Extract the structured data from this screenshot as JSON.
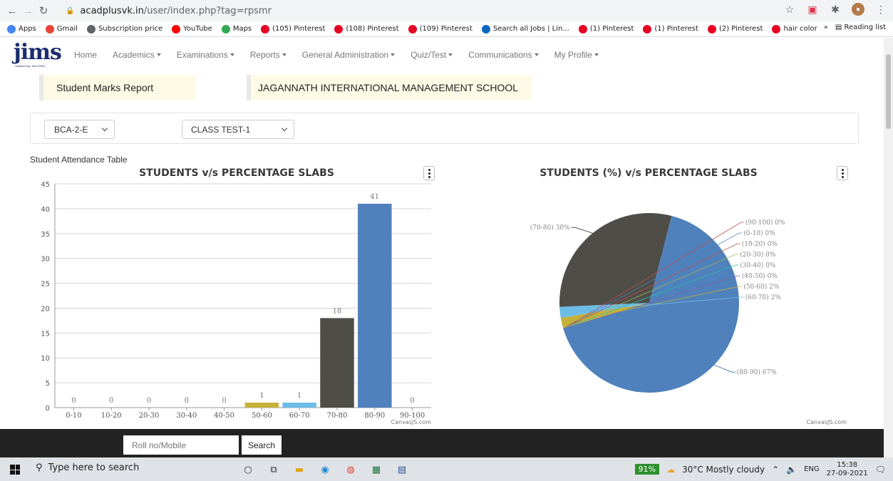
{
  "browser": {
    "url_host": "acadplusvk.in",
    "url_path": "/user/index.php?tag=rpsmr",
    "bookmarks": [
      {
        "label": "Apps",
        "color": "#4285f4"
      },
      {
        "label": "Gmail",
        "color": "#ea4335"
      },
      {
        "label": "Subscription price",
        "color": "#5f6368"
      },
      {
        "label": "YouTube",
        "color": "#ff0000"
      },
      {
        "label": "Maps",
        "color": "#34a853"
      },
      {
        "label": "(105) Pinterest",
        "color": "#e60023"
      },
      {
        "label": "(108) Pinterest",
        "color": "#e60023"
      },
      {
        "label": "(109) Pinterest",
        "color": "#e60023"
      },
      {
        "label": "Search all Jobs | Lin...",
        "color": "#0a66c2"
      },
      {
        "label": "(1) Pinterest",
        "color": "#e60023"
      },
      {
        "label": "(1) Pinterest",
        "color": "#e60023"
      },
      {
        "label": "(2) Pinterest",
        "color": "#e60023"
      },
      {
        "label": "hair color",
        "color": "#e60023"
      }
    ],
    "more": "»",
    "reading_list": "Reading list"
  },
  "nav": {
    "logo": "jims",
    "logo_sub": "Vasant Kunj, New Delhi",
    "items": [
      {
        "label": "Home",
        "dropdown": false
      },
      {
        "label": "Academics",
        "dropdown": true
      },
      {
        "label": "Examinations",
        "dropdown": true
      },
      {
        "label": "Reports",
        "dropdown": true
      },
      {
        "label": "General Administration",
        "dropdown": true
      },
      {
        "label": "Quiz/Test",
        "dropdown": true
      },
      {
        "label": "Communications",
        "dropdown": true
      },
      {
        "label": "My Profile",
        "dropdown": true
      }
    ]
  },
  "header": {
    "report_title": "Student Marks Report",
    "institute": "JAGANNATH INTERNATIONAL MANAGEMENT SCHOOL"
  },
  "filters": {
    "class_value": "BCA-2-E",
    "test_value": "CLASS TEST-1"
  },
  "section_label": "Student Attendance Table",
  "chart_data": [
    {
      "type": "bar",
      "title": "STUDENTS v/s PERCENTAGE SLABS",
      "categories": [
        "0-10",
        "10-20",
        "20-30",
        "30-40",
        "40-50",
        "50-60",
        "60-70",
        "70-80",
        "80-90",
        "90-100"
      ],
      "values": [
        0,
        0,
        0,
        0,
        0,
        1,
        1,
        18,
        41,
        0
      ],
      "colors": [
        "#4f81bc",
        "#c0504e",
        "#9bbb58",
        "#23bfaa",
        "#8064a1",
        "#c4b13a",
        "#6cbce8",
        "#4e4d48",
        "#4f81bc",
        "#c0504e"
      ],
      "ylim": [
        0,
        45
      ],
      "yticks": [
        0,
        5,
        10,
        15,
        20,
        25,
        30,
        35,
        40,
        45
      ],
      "credit": "CanvasJS.com",
      "grid": true
    },
    {
      "type": "pie",
      "title": "STUDENTS (%) v/s PERCENTAGE SLABS",
      "slices": [
        {
          "label": "(80-90) 67%",
          "value": 67,
          "color": "#4f81bc"
        },
        {
          "label": "(90-100) 0%",
          "value": 0,
          "color": "#c0504e"
        },
        {
          "label": "(0-10) 0%",
          "value": 0,
          "color": "#4f81bc"
        },
        {
          "label": "(10-20) 0%",
          "value": 0,
          "color": "#c0504e"
        },
        {
          "label": "(20-30) 0%",
          "value": 0,
          "color": "#9bbb58"
        },
        {
          "label": "(30-40) 0%",
          "value": 0,
          "color": "#23bfaa"
        },
        {
          "label": "(40-50) 0%",
          "value": 0,
          "color": "#8064a1"
        },
        {
          "label": "(50-60) 2%",
          "value": 2,
          "color": "#c4b13a"
        },
        {
          "label": "(60-70) 2%",
          "value": 2,
          "color": "#6cbce8"
        },
        {
          "label": "(70-80) 30%",
          "value": 30,
          "color": "#4e4d48"
        }
      ],
      "credit": "CanvasJS.com"
    }
  ],
  "footer": {
    "roll_placeholder": "Roll no/Mobile",
    "search_label": "Search"
  },
  "taskbar": {
    "search_placeholder": "Type here to search",
    "battery": "91%",
    "weather": "30°C  Mostly cloudy",
    "lang": "ENG",
    "time": "15:38",
    "date": "27-09-2021"
  }
}
